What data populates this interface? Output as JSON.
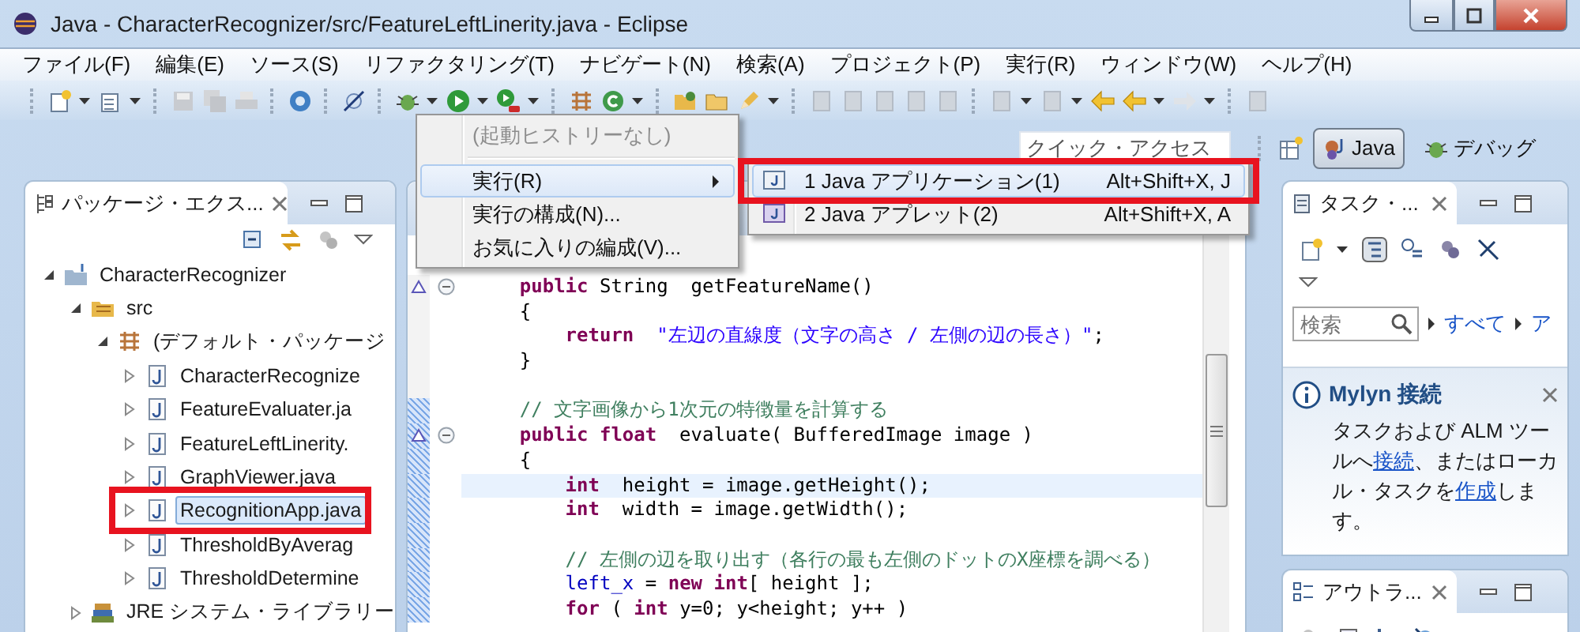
{
  "window": {
    "title": "Java - CharacterRecognizer/src/FeatureLeftLinerity.java - Eclipse"
  },
  "menu_bar": [
    "ファイル(F)",
    "編集(E)",
    "ソース(S)",
    "リファクタリング(T)",
    "ナビゲート(N)",
    "検索(A)",
    "プロジェクト(P)",
    "実行(R)",
    "ウィンドウ(W)",
    "ヘルプ(H)"
  ],
  "quick_access": {
    "placeholder": "クイック・アクセス"
  },
  "perspectives": [
    {
      "label": "Java",
      "kind": "java",
      "selected": true
    },
    {
      "label": "デバッグ",
      "kind": "debug",
      "selected": false
    }
  ],
  "package_explorer": {
    "title": "パッケージ・エクス...",
    "tree": [
      {
        "label": "CharacterRecognizer",
        "kind": "project",
        "expanded": true,
        "selected": false,
        "highlighted": false,
        "children": [
          {
            "label": "src",
            "kind": "source_folder",
            "expanded": true,
            "selected": false,
            "highlighted": false,
            "children": [
              {
                "label": "(デフォルト・パッケージ",
                "kind": "package",
                "expanded": true,
                "selected": false,
                "highlighted": false,
                "children": [
                  {
                    "label": "CharacterRecognize",
                    "kind": "java_file",
                    "expanded": false,
                    "selected": false,
                    "highlighted": false
                  },
                  {
                    "label": "FeatureEvaluater.ja",
                    "kind": "java_file",
                    "expanded": false,
                    "selected": false,
                    "highlighted": false
                  },
                  {
                    "label": "FeatureLeftLinerity.",
                    "kind": "java_file",
                    "expanded": false,
                    "selected": false,
                    "highlighted": false
                  },
                  {
                    "label": "GraphViewer.java",
                    "kind": "java_file",
                    "expanded": false,
                    "selected": false,
                    "highlighted": false
                  },
                  {
                    "label": "RecognitionApp.java",
                    "kind": "java_file",
                    "expanded": false,
                    "selected": true,
                    "highlighted": true
                  },
                  {
                    "label": "ThresholdByAverag",
                    "kind": "java_file",
                    "expanded": false,
                    "selected": false,
                    "highlighted": false
                  },
                  {
                    "label": "ThresholdDetermine",
                    "kind": "java_file",
                    "expanded": false,
                    "selected": false,
                    "highlighted": false
                  }
                ]
              }
            ]
          },
          {
            "label": "JRE システム・ライブラリー",
            "kind": "library",
            "expanded": false,
            "selected": false,
            "highlighted": false
          }
        ]
      }
    ]
  },
  "editor": {
    "lines": [
      {
        "fold": true,
        "current": false,
        "changed": false,
        "segments": [
          {
            "kind": "keyword",
            "text": "    public"
          },
          {
            "kind": "plain",
            "text": " String  getFeatureName()"
          }
        ]
      },
      {
        "fold": false,
        "current": false,
        "changed": false,
        "segments": [
          {
            "kind": "plain",
            "text": "    {"
          }
        ]
      },
      {
        "fold": false,
        "current": false,
        "changed": false,
        "segments": [
          {
            "kind": "keyword",
            "text": "        return"
          },
          {
            "kind": "string",
            "text": "  \"左辺の直線度（文字の高さ / 左側の辺の長さ）\""
          },
          {
            "kind": "plain",
            "text": ";"
          }
        ]
      },
      {
        "fold": false,
        "current": false,
        "changed": false,
        "segments": [
          {
            "kind": "plain",
            "text": "    }"
          }
        ]
      },
      {
        "fold": false,
        "current": false,
        "changed": false
      },
      {
        "fold": false,
        "current": false,
        "changed": true,
        "segments": [
          {
            "kind": "comment",
            "text": "    // 文字画像から1次元の特徴量を計算する"
          }
        ]
      },
      {
        "fold": true,
        "current": false,
        "changed": true,
        "segments": [
          {
            "kind": "keyword",
            "text": "    public float"
          },
          {
            "kind": "plain",
            "text": "  evaluate( BufferedImage image )"
          }
        ]
      },
      {
        "fold": false,
        "current": false,
        "changed": true,
        "segments": [
          {
            "kind": "plain",
            "text": "    {"
          }
        ]
      },
      {
        "fold": false,
        "current": true,
        "changed": true,
        "segments": [
          {
            "kind": "keyword",
            "text": "        int"
          },
          {
            "kind": "plain",
            "text": "  height = image.getHeight();"
          }
        ]
      },
      {
        "fold": false,
        "current": false,
        "changed": true,
        "segments": [
          {
            "kind": "keyword",
            "text": "        int"
          },
          {
            "kind": "plain",
            "text": "  width = image.getWidth();"
          }
        ]
      },
      {
        "fold": false,
        "current": false,
        "changed": true
      },
      {
        "fold": false,
        "current": false,
        "changed": true,
        "segments": [
          {
            "kind": "comment",
            "text": "        // 左側の辺を取り出す（各行の最も左側のドットのX座標を調べる）"
          }
        ]
      },
      {
        "fold": false,
        "current": false,
        "changed": true,
        "segments": [
          {
            "kind": "field",
            "text": "        left_x"
          },
          {
            "kind": "plain",
            "text": " = "
          },
          {
            "kind": "keyword",
            "text": "new int"
          },
          {
            "kind": "plain",
            "text": "[ height ];"
          }
        ]
      },
      {
        "fold": false,
        "current": false,
        "changed": true,
        "segments": [
          {
            "kind": "keyword",
            "text": "        for"
          },
          {
            "kind": "plain",
            "text": " ( "
          },
          {
            "kind": "keyword",
            "text": "int"
          },
          {
            "kind": "plain",
            "text": " y=0; y<height; y++ )"
          }
        ]
      }
    ]
  },
  "run_menu": {
    "items": [
      {
        "kind": "disabled",
        "label": "(起動ヒストリーなし)",
        "selected": false
      },
      {
        "kind": "separator"
      },
      {
        "kind": "submenu",
        "label": "実行(R)",
        "selected": true
      },
      {
        "kind": "item",
        "label": "実行の構成(N)...",
        "selected": false
      },
      {
        "kind": "item",
        "label": "お気に入りの編成(V)...",
        "selected": false
      }
    ],
    "submenu": [
      {
        "kind": "application",
        "label": "1 Java アプリケーション(1)",
        "shortcut": "Alt+Shift+X, J",
        "selected": true,
        "highlighted": true
      },
      {
        "kind": "applet",
        "label": "2 Java アプレット(2)",
        "shortcut": "Alt+Shift+X, A",
        "selected": false,
        "highlighted": false
      }
    ]
  },
  "tasks": {
    "title": "タスク・...",
    "search": {
      "placeholder": "検索"
    },
    "filters": [
      "すべて",
      "ア"
    ],
    "mylyn": {
      "title": "Mylyn 接続",
      "text_1": "タスクおよび ALM ツールへ",
      "link_1": "接続",
      "text_2": "、またはローカル・タスクを",
      "link_2": "作成",
      "text_3": "します。"
    }
  },
  "outline": {
    "title": "アウトラ..."
  }
}
